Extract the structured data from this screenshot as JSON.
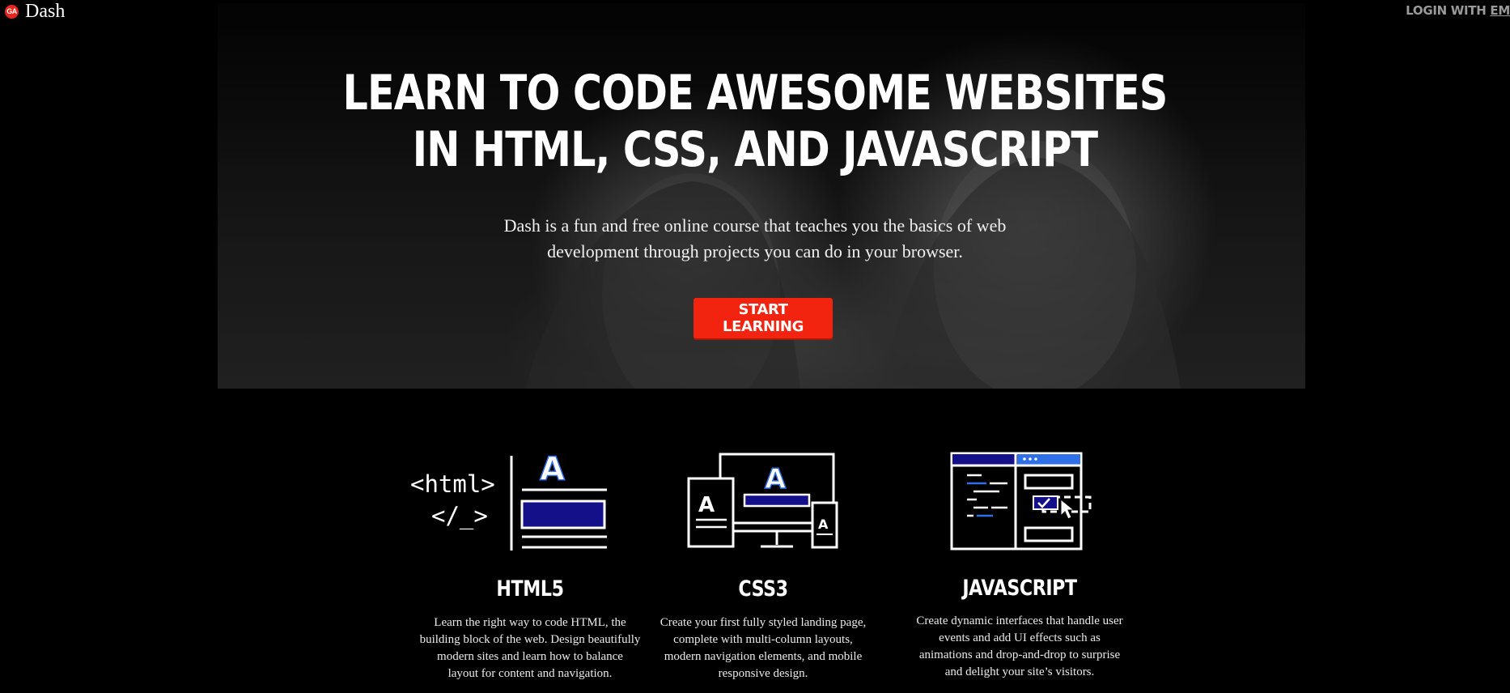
{
  "brand": {
    "badge": "GA",
    "name": "Dash"
  },
  "header": {
    "login_prefix": "LOGIN WITH ",
    "login_link": "EM"
  },
  "hero": {
    "headline_line1": "LEARN TO CODE AWESOME WEBSITES",
    "headline_line2": "IN HTML, CSS, AND JAVASCRIPT",
    "subtitle_line1": "Dash is a fun and free online course that teaches you the basics of web",
    "subtitle_line2": "development through projects you can do in your browser.",
    "cta_label": "START LEARNING"
  },
  "features": [
    {
      "title": "HTML5",
      "icon_text1": "<html>",
      "icon_text2": "</_>",
      "lines": [
        "Learn the right way to code HTML, the",
        "building block of the web. Design beautifully",
        "modern sites and learn how to balance",
        "layout for content and navigation."
      ]
    },
    {
      "title": "CSS3",
      "lines": [
        "Create your first fully styled landing page,",
        "complete with multi-column layouts,",
        "modern navigation elements, and mobile",
        "responsive design."
      ]
    },
    {
      "title": "JAVASCRIPT",
      "lines": [
        "Create dynamic interfaces that handle user",
        "events and add UI effects such as",
        "animations and drop-and-drop to surprise",
        "and delight your site’s visitors."
      ]
    }
  ],
  "colors": {
    "accent": "#f2240f",
    "navy": "#13108a",
    "blue": "#2f6fe8",
    "background": "#000000"
  }
}
